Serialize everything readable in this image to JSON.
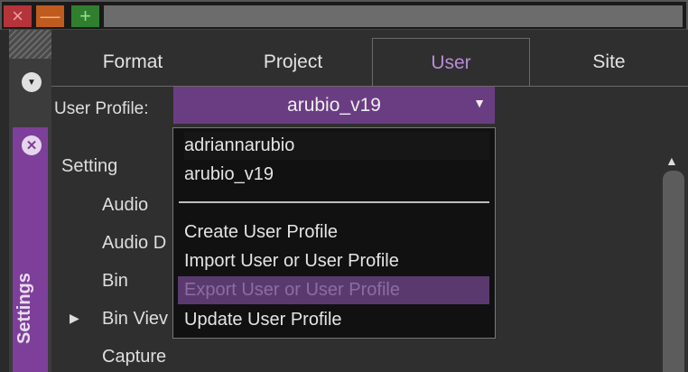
{
  "window": {
    "close_glyph": "×",
    "minimize_glyph": "—",
    "maximize_glyph": "+"
  },
  "sidebar": {
    "vertical_label": "Settings",
    "down_icon_glyph": "▼",
    "close_icon_glyph": "✕"
  },
  "tabs": [
    {
      "label": "Format",
      "active": false
    },
    {
      "label": "Project",
      "active": false
    },
    {
      "label": "User",
      "active": true
    },
    {
      "label": "Site",
      "active": false
    }
  ],
  "profile": {
    "label": "User Profile:",
    "value": "arubio_v19",
    "caret": "▼"
  },
  "settings_list": {
    "header": "Setting",
    "items": [
      "Audio",
      "Audio D",
      "Bin",
      "Bin Viev",
      "Capture"
    ],
    "expand_arrow": "▶"
  },
  "scroll": {
    "up_glyph": "▲"
  },
  "dropdown": {
    "profiles": [
      "adriannarubio",
      "arubio_v19"
    ],
    "actions": [
      "Create User Profile",
      "Import User or User Profile",
      "Export User or User Profile",
      "Update User Profile"
    ]
  },
  "colors": {
    "accent": "#7e3f9a",
    "select": "#6a3d83",
    "active_tab_text": "#b98ad8",
    "highlight": "#5a3a6e"
  }
}
